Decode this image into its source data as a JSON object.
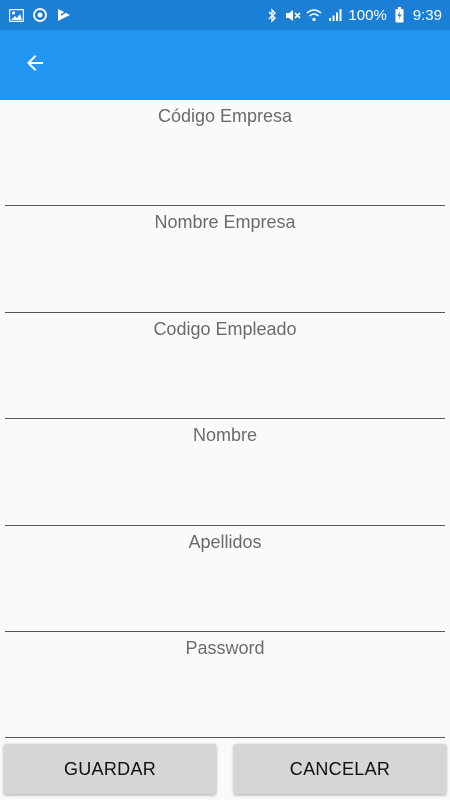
{
  "status_bar": {
    "battery": "100%",
    "time": "9:39",
    "left_icons": [
      "image-icon",
      "sync-icon",
      "flag-icon"
    ],
    "right_icons": [
      "bluetooth-icon",
      "mute-icon",
      "wifi-icon",
      "signal-icon",
      "battery-icon"
    ]
  },
  "app_bar": {
    "color": "#2196f3",
    "back_icon": "arrow-left-icon"
  },
  "form": {
    "fields": [
      {
        "label": "Código Empresa",
        "value": ""
      },
      {
        "label": "Nombre Empresa",
        "value": ""
      },
      {
        "label": "Codigo Empleado",
        "value": ""
      },
      {
        "label": "Nombre",
        "value": ""
      },
      {
        "label": "Apellidos",
        "value": ""
      },
      {
        "label": "Password",
        "value": ""
      }
    ]
  },
  "buttons": {
    "save_label": "GUARDAR",
    "cancel_label": "CANCELAR"
  }
}
